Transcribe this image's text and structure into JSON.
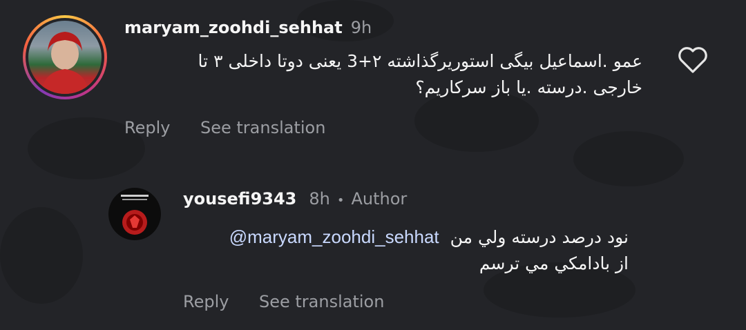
{
  "comments": [
    {
      "username": "maryam_zoohdi_sehhat",
      "time": "9h",
      "text_line1": "عمو .اسماعیل بیگی استوریرگذاشته ۲+3 یعنی دوتا داخلی ۳ تا",
      "text_line2": "خارجی .درسته .یا باز سرکاریم؟",
      "reply_label": "Reply",
      "translate_label": "See translation"
    },
    {
      "username": "yousefi9343",
      "time": "8h",
      "separator": "•",
      "author_badge": "Author",
      "mention": "@maryam_zoohdi_sehhat",
      "text_line1": "نود درصد درسته ولي من",
      "text_line2": "از بادامكي مي ترسم",
      "reply_label": "Reply",
      "translate_label": "See translation"
    }
  ],
  "colors": {
    "background": "#232428",
    "text": "#f5f5f5",
    "muted": "#9c9ea3",
    "mention": "#c9d9ff"
  },
  "icons": {
    "like": "heart-outline-icon"
  }
}
